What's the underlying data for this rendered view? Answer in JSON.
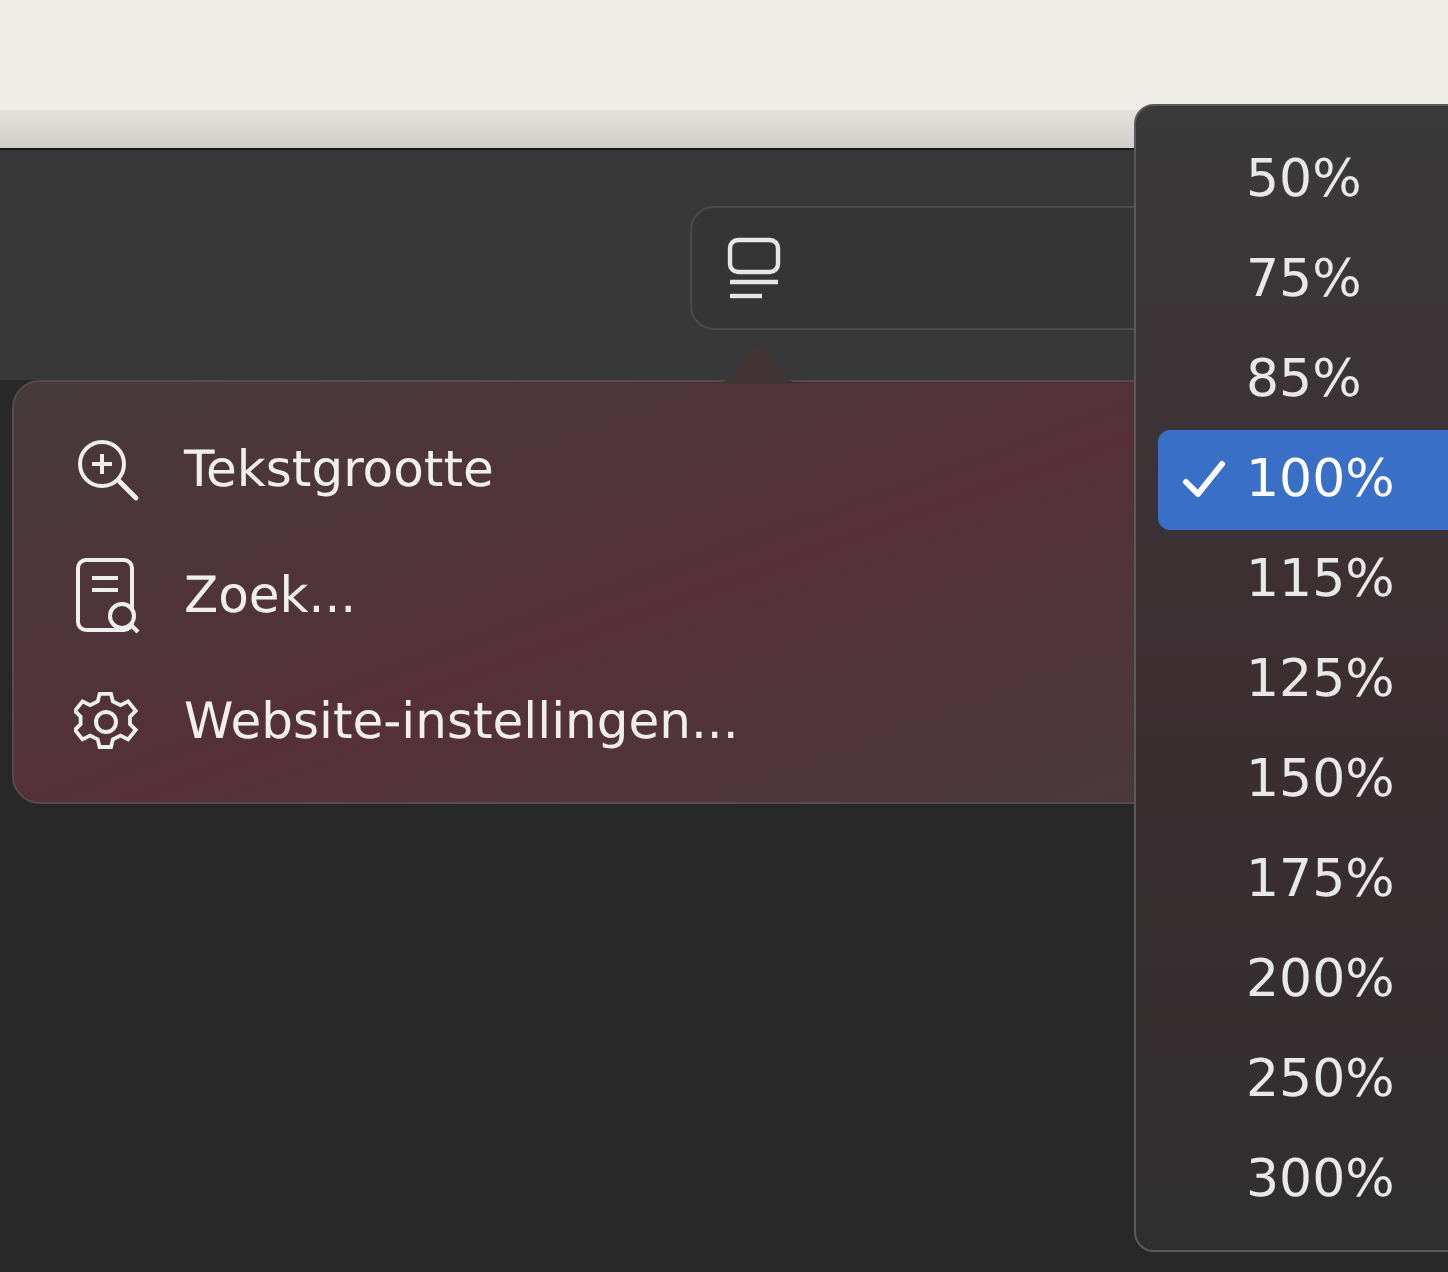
{
  "popover_menu": {
    "items": [
      {
        "kind": "zoom",
        "label": "Tekstgrootte"
      },
      {
        "kind": "find",
        "label": "Zoek..."
      },
      {
        "kind": "settings",
        "label": "Website-instellingen..."
      }
    ]
  },
  "zoom_menu": {
    "options": [
      {
        "label": "50%",
        "selected": false
      },
      {
        "label": "75%",
        "selected": false
      },
      {
        "label": "85%",
        "selected": false
      },
      {
        "label": "100%",
        "selected": true
      },
      {
        "label": "115%",
        "selected": false
      },
      {
        "label": "125%",
        "selected": false
      },
      {
        "label": "150%",
        "selected": false
      },
      {
        "label": "175%",
        "selected": false
      },
      {
        "label": "200%",
        "selected": false
      },
      {
        "label": "250%",
        "selected": false
      },
      {
        "label": "300%",
        "selected": false
      }
    ]
  }
}
